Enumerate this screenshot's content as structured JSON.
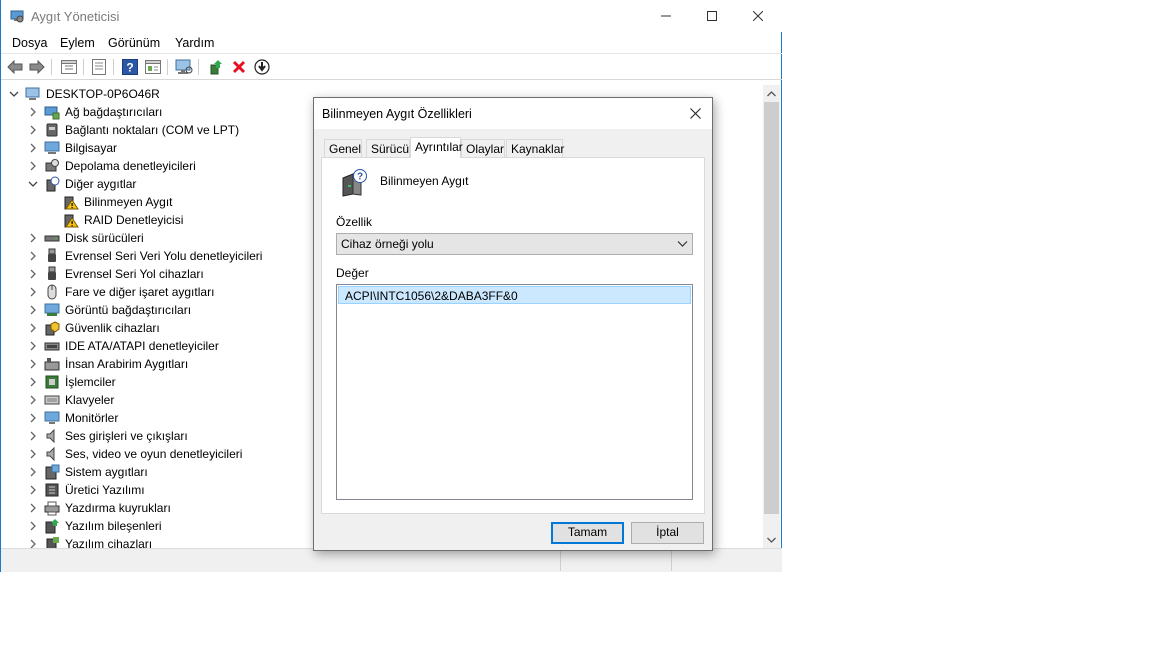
{
  "window": {
    "title": "Aygıt Yöneticisi"
  },
  "menu": [
    "Dosya",
    "Eylem",
    "Görünüm",
    "Yardım"
  ],
  "toolbar": {
    "icons": [
      "back-icon",
      "forward-icon",
      "properties-view-icon",
      "list-view-icon",
      "help-icon",
      "action-view-icon",
      "monitor-scan-icon",
      "update-driver-icon",
      "uninstall-icon",
      "disable-device-icon"
    ]
  },
  "tree": {
    "root": "DESKTOP-0P6O46R",
    "items": [
      {
        "label": "Ağ bağdaştırıcıları",
        "icon": "network-adapter-icon",
        "level": 1,
        "expanded": false
      },
      {
        "label": "Bağlantı noktaları (COM ve LPT)",
        "icon": "port-icon",
        "level": 1,
        "expanded": false
      },
      {
        "label": "Bilgisayar",
        "icon": "computer-icon",
        "level": 1,
        "expanded": false
      },
      {
        "label": "Depolama denetleyicileri",
        "icon": "storage-controller-icon",
        "level": 1,
        "expanded": false
      },
      {
        "label": "Diğer aygıtlar",
        "icon": "other-devices-icon",
        "level": 1,
        "expanded": true
      },
      {
        "label": "Bilinmeyen Aygıt",
        "icon": "warning-device-icon",
        "level": 2
      },
      {
        "label": "RAID Denetleyicisi",
        "icon": "warning-device-icon",
        "level": 2
      },
      {
        "label": "Disk sürücüleri",
        "icon": "disk-drive-icon",
        "level": 1,
        "expanded": false
      },
      {
        "label": "Evrensel Seri Veri Yolu denetleyicileri",
        "icon": "usb-icon",
        "level": 1,
        "expanded": false
      },
      {
        "label": "Evrensel Seri Yol cihazları",
        "icon": "usb-icon",
        "level": 1,
        "expanded": false
      },
      {
        "label": "Fare ve diğer işaret aygıtları",
        "icon": "mouse-icon",
        "level": 1,
        "expanded": false
      },
      {
        "label": "Görüntü bağdaştırıcıları",
        "icon": "display-adapter-icon",
        "level": 1,
        "expanded": false
      },
      {
        "label": "Güvenlik cihazları",
        "icon": "security-device-icon",
        "level": 1,
        "expanded": false
      },
      {
        "label": "IDE ATA/ATAPI denetleyiciler",
        "icon": "ide-controller-icon",
        "level": 1,
        "expanded": false
      },
      {
        "label": "İnsan Arabirim Aygıtları",
        "icon": "hid-icon",
        "level": 1,
        "expanded": false
      },
      {
        "label": "İşlemciler",
        "icon": "processor-icon",
        "level": 1,
        "expanded": false
      },
      {
        "label": "Klavyeler",
        "icon": "keyboard-icon",
        "level": 1,
        "expanded": false
      },
      {
        "label": "Monitörler",
        "icon": "monitor-icon",
        "level": 1,
        "expanded": false
      },
      {
        "label": "Ses girişleri ve çıkışları",
        "icon": "audio-icon",
        "level": 1,
        "expanded": false
      },
      {
        "label": "Ses, video ve oyun denetleyicileri",
        "icon": "audio-icon",
        "level": 1,
        "expanded": false
      },
      {
        "label": "Sistem aygıtları",
        "icon": "system-device-icon",
        "level": 1,
        "expanded": false
      },
      {
        "label": "Üretici Yazılımı",
        "icon": "firmware-icon",
        "level": 1,
        "expanded": false
      },
      {
        "label": "Yazdırma kuyrukları",
        "icon": "printer-icon",
        "level": 1,
        "expanded": false
      },
      {
        "label": "Yazılım bileşenleri",
        "icon": "software-component-icon",
        "level": 1,
        "expanded": false
      },
      {
        "label": "Yazılım cihazları",
        "icon": "software-device-icon",
        "level": 1,
        "expanded": false
      }
    ]
  },
  "dialog": {
    "title": "Bilinmeyen Aygıt Özellikleri",
    "tabs": [
      "Genel",
      "Sürücü",
      "Ayrıntılar",
      "Olaylar",
      "Kaynaklar"
    ],
    "active_tab": "Ayrıntılar",
    "device_name": "Bilinmeyen Aygıt",
    "property_label": "Özellik",
    "property_value": "Cihaz örneği yolu",
    "value_label": "Değer",
    "value_text": "ACPI\\INTC1056\\2&DABA3FF&0",
    "ok_label": "Tamam",
    "cancel_label": "İptal"
  },
  "colors": {
    "accent": "#0078d7",
    "selection": "#cce8ff",
    "warning": "#f5c211",
    "error": "#e81123"
  }
}
